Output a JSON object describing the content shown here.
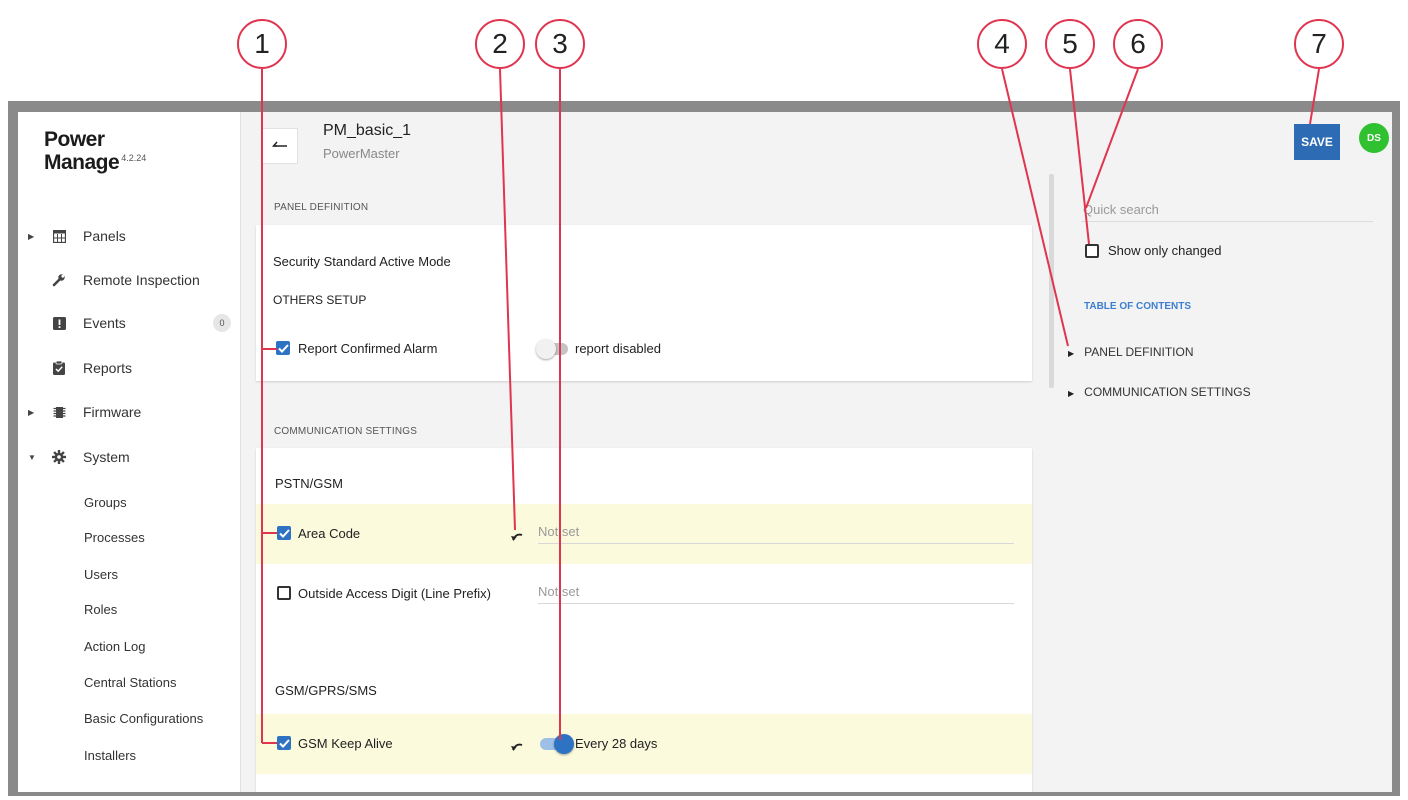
{
  "app": {
    "logo_line1": "Power",
    "logo_line2": "Manage",
    "version": "4.2.24"
  },
  "sidebar": {
    "items": [
      {
        "label": "Panels",
        "icon": "grid-icon",
        "expandable": true
      },
      {
        "label": "Remote Inspection",
        "icon": "wrench-icon",
        "expandable": false
      },
      {
        "label": "Events",
        "icon": "alert-icon",
        "expandable": false,
        "badge": "0"
      },
      {
        "label": "Reports",
        "icon": "clipboard-icon",
        "expandable": false
      },
      {
        "label": "Firmware",
        "icon": "chip-icon",
        "expandable": true
      },
      {
        "label": "System",
        "icon": "gear-icon",
        "expandable": true,
        "expanded": true
      }
    ],
    "system_subitems": [
      "Groups",
      "Processes",
      "Users",
      "Roles",
      "Action Log",
      "Central Stations",
      "Basic Configurations",
      "Installers"
    ]
  },
  "header": {
    "title": "PM_basic_1",
    "subtitle": "PowerMaster",
    "save_label": "SAVE",
    "avatar_initials": "DS"
  },
  "panel_definition": {
    "section_label": "PANEL DEFINITION",
    "mode_label": "Security Standard Active Mode",
    "group_label": "OTHERS SETUP",
    "report_confirmed_alarm": {
      "label": "Report Confirmed Alarm",
      "checked": true,
      "toggle_on": false,
      "toggle_text": "report disabled"
    }
  },
  "communication_settings": {
    "section_label": "COMMUNICATION SETTINGS",
    "pstn_label": "PSTN/GSM",
    "area_code": {
      "label": "Area Code",
      "checked": true,
      "value_placeholder": "Not set",
      "changed": true
    },
    "outside_access": {
      "label": "Outside Access Digit (Line Prefix)",
      "checked": false,
      "value_placeholder": "Not set"
    },
    "gsm_label": "GSM/GPRS/SMS",
    "gsm_keep_alive": {
      "label": "GSM Keep Alive",
      "checked": true,
      "toggle_on": true,
      "toggle_text": "Every 28 days",
      "changed": true
    }
  },
  "right_pane": {
    "search_placeholder": "Quick search",
    "show_only_changed": "Show only changed",
    "toc_title": "TABLE OF CONTENTS",
    "toc_items": [
      "PANEL DEFINITION",
      "COMMUNICATION SETTINGS"
    ]
  },
  "callouts": [
    "1",
    "2",
    "3",
    "4",
    "5",
    "6",
    "7"
  ],
  "colors": {
    "accent": "#2e72c4",
    "save": "#2d6cb5",
    "avatar": "#2fc12f",
    "callout": "#e0354f",
    "changed_row": "#fbfadd"
  }
}
